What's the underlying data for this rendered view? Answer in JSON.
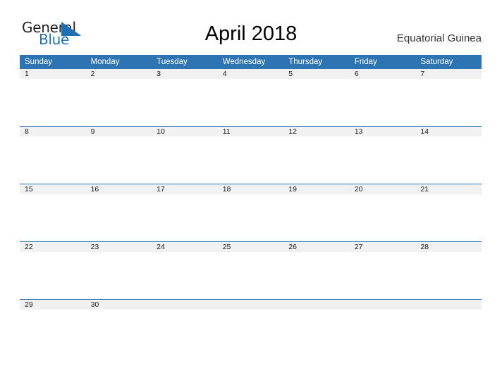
{
  "brand": {
    "name_part1": "General",
    "name_part2": "Blue",
    "triangle_icon": "triangle-icon",
    "color_dark": "#231f20",
    "color_blue": "#1f6fb5"
  },
  "header": {
    "title": "April 2018",
    "region": "Equatorial Guinea"
  },
  "theme": {
    "header_blue": "#2d74b2",
    "band_gray": "#f1f1f1",
    "text_dark": "#1a1a1a"
  },
  "calendar": {
    "month": "April",
    "year": "2018",
    "weekday_headers": [
      "Sunday",
      "Monday",
      "Tuesday",
      "Wednesday",
      "Thursday",
      "Friday",
      "Saturday"
    ],
    "weeks": [
      [
        "1",
        "2",
        "3",
        "4",
        "5",
        "6",
        "7"
      ],
      [
        "8",
        "9",
        "10",
        "11",
        "12",
        "13",
        "14"
      ],
      [
        "15",
        "16",
        "17",
        "18",
        "19",
        "20",
        "21"
      ],
      [
        "22",
        "23",
        "24",
        "25",
        "26",
        "27",
        "28"
      ],
      [
        "29",
        "30",
        "",
        "",
        "",
        "",
        ""
      ]
    ]
  }
}
